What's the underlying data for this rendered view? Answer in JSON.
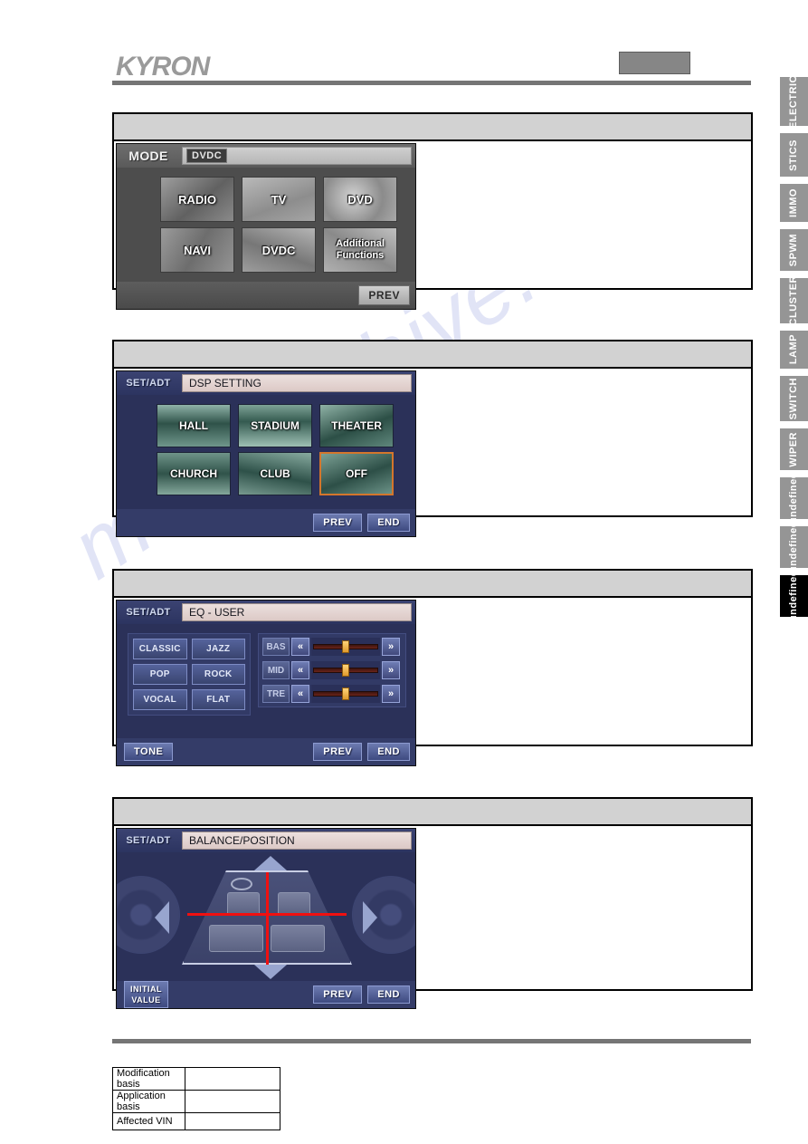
{
  "page": {
    "brand_logo": "KYRON",
    "watermark": "manualshive.com"
  },
  "side_tabs": [
    {
      "label": "ELECTRIC",
      "active": false
    },
    {
      "label": "STICS",
      "active": false
    },
    {
      "label": "IMMO",
      "active": false
    },
    {
      "label": "SPWM",
      "active": false
    },
    {
      "label": "CLUSTER",
      "active": false
    },
    {
      "label": "LAMP",
      "active": false
    },
    {
      "label": "SWITCH",
      "active": false
    },
    {
      "label": "WIPER",
      "active": false
    },
    {
      "label": "undefined",
      "active": false
    },
    {
      "label": "undefined",
      "active": false
    },
    {
      "label": "undefined",
      "active": true
    }
  ],
  "blocks": [
    {
      "caption": "",
      "screen": {
        "tag": "MODE",
        "field_badge": "DVDC",
        "field_text": "",
        "tiles": [
          {
            "label": "RADIO",
            "variant": "t-radio"
          },
          {
            "label": "TV",
            "variant": "t-tv"
          },
          {
            "label": "DVD",
            "variant": "t-dvd"
          },
          {
            "label": "NAVI",
            "variant": "t-navi"
          },
          {
            "label": "DVDC",
            "variant": "t-dvdc"
          },
          {
            "label": "Additional\nFunctions",
            "variant": "t-add"
          }
        ],
        "buttons": {
          "prev": "PREV"
        }
      }
    },
    {
      "caption": "",
      "screen": {
        "tag": "SET/ADT",
        "field_text": "DSP SETTING",
        "tiles": [
          {
            "label": "HALL",
            "variant": "d-hall",
            "selected": false
          },
          {
            "label": "STADIUM",
            "variant": "d-stadium",
            "selected": false
          },
          {
            "label": "THEATER",
            "variant": "d-theater",
            "selected": false
          },
          {
            "label": "CHURCH",
            "variant": "d-church",
            "selected": false
          },
          {
            "label": "CLUB",
            "variant": "d-club",
            "selected": false
          },
          {
            "label": "OFF",
            "variant": "d-off",
            "selected": true
          }
        ],
        "buttons": {
          "prev": "PREV",
          "end": "END"
        }
      }
    },
    {
      "caption": "",
      "screen": {
        "tag": "SET/ADT",
        "field_text": "EQ - USER",
        "presets": [
          "CLASSIC",
          "JAZZ",
          "POP",
          "ROCK",
          "VOCAL",
          "FLAT"
        ],
        "sliders": [
          {
            "label": "BAS",
            "dec": "«",
            "inc": "»",
            "value_pct": 50
          },
          {
            "label": "MID",
            "dec": "«",
            "inc": "»",
            "value_pct": 50
          },
          {
            "label": "TRE",
            "dec": "«",
            "inc": "»",
            "value_pct": 50
          }
        ],
        "buttons": {
          "tone": "TONE",
          "prev": "PREV",
          "end": "END"
        }
      }
    },
    {
      "caption": "",
      "screen": {
        "tag": "SET/ADT",
        "field_text": "BALANCE/POSITION",
        "arrows": [
          "up-arrow",
          "down-arrow",
          "left-arrow",
          "right-arrow"
        ],
        "buttons": {
          "initial_value": "INITIAL\nVALUE",
          "prev": "PREV",
          "end": "END"
        }
      }
    }
  ],
  "meta_table": {
    "rows": [
      {
        "key": "Modification basis",
        "value": ""
      },
      {
        "key": "Application basis",
        "value": ""
      },
      {
        "key": "Affected VIN",
        "value": ""
      }
    ]
  }
}
